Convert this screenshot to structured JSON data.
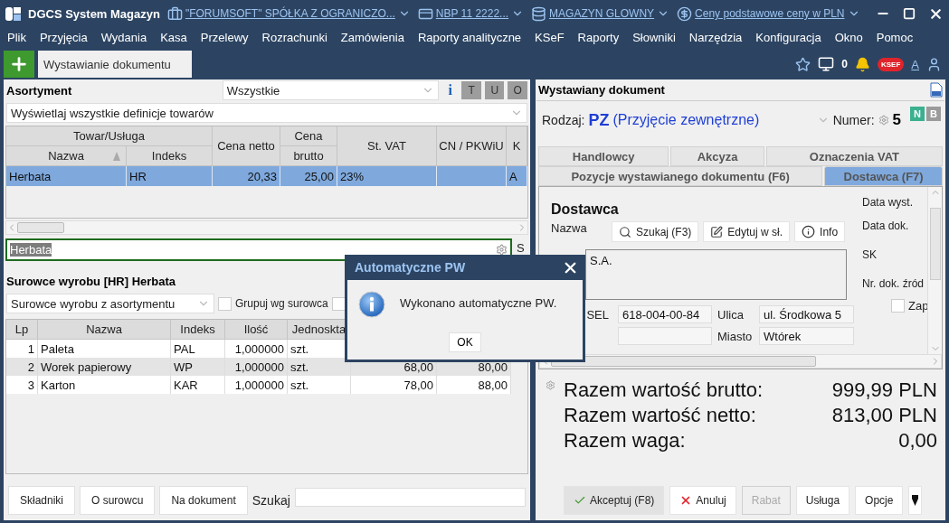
{
  "window": {
    "app_title": "DGCS System Magazyn",
    "context": [
      {
        "kind": "company",
        "label": "\"FORUMSOFT\" SPÓŁKA Z OGRANICZO..."
      },
      {
        "kind": "bank",
        "label": "NBP 11 2222..."
      },
      {
        "kind": "warehouse",
        "label": "MAGAZYN GLOWNY"
      },
      {
        "kind": "prices",
        "label": "Ceny podstawowe ceny w PLN"
      }
    ]
  },
  "menu": [
    "Plik",
    "Przyjęcia",
    "Wydania",
    "Kasa",
    "Przelewy",
    "Rozrachunki",
    "Zamówienia",
    "Raporty analityczne",
    "KSeF",
    "Raporty",
    "Słowniki",
    "Narzędzia",
    "Konfiguracja",
    "Okno",
    "Pomoc"
  ],
  "tabs": [
    {
      "label": "Wystawianie dokumentu",
      "selected": true
    }
  ],
  "toolbar": {
    "monitor_count": "0",
    "ksef": "KSEF",
    "font_size": "A"
  },
  "assortment": {
    "title": "Asortyment",
    "filter": "Wszystkie",
    "info": "i",
    "view_buttons": [
      "T",
      "U",
      "O"
    ],
    "definitions": "Wyświetlaj wszystkie definicje towarów",
    "table": {
      "group_label": "Towar/Usługa",
      "name_column": {
        "label": "Nazwa",
        "sorted": true
      },
      "index_column": "Indeks",
      "net_column": "Cena netto",
      "gross_column": [
        "Cena",
        "brutto"
      ],
      "vat_column": "St. VAT",
      "cn_column": "CN / PKWiU",
      "column_7": "K",
      "rows": [
        {
          "name": "Herbata",
          "index": "HR",
          "net": "20,33",
          "gross": "25,00",
          "vat": "23%",
          "column_7": "A",
          "selected": true
        }
      ]
    },
    "search": {
      "value": "Herbata",
      "trailing": "S"
    }
  },
  "components": {
    "title": "Surowce wyrobu [HR] Herbata",
    "source": "Surowce wyrobu z asortymentu",
    "checkboxes": [
      {
        "label": "Grupuj wg surowca",
        "checked": false
      },
      {
        "checked": false
      }
    ],
    "columns": [
      "Lp",
      "Nazwa",
      "Indeks",
      "Ilość",
      "Jednoskta"
    ],
    "rows": [
      {
        "lp": "1",
        "name": "Paleta",
        "index": "PAL",
        "qty": "1,000000",
        "unit": "szt."
      },
      {
        "lp": "2",
        "name": "Worek papierowy",
        "index": "WP",
        "qty": "1,000000",
        "unit": "szt.",
        "column_6": "68,00",
        "column_7": "80,00"
      },
      {
        "lp": "3",
        "name": "Karton",
        "index": "KAR",
        "qty": "1,000000",
        "unit": "szt.",
        "column_6": "78,00",
        "column_7": "88,00"
      }
    ],
    "buttons": [
      "Składniki",
      "O surowcu",
      "Na dokument"
    ],
    "search_label": "Szukaj"
  },
  "document": {
    "title": "Wystawiany dokument",
    "type_label": "Rodzaj:",
    "type_code": "PZ",
    "type_name": "(Przyjęcie zewnętrzne)",
    "number_label": "Numer:",
    "number": "5",
    "flags": [
      {
        "label": "N",
        "on": true
      },
      {
        "label": "B",
        "on": false
      }
    ],
    "tab_rows": [
      {
        "tabs": [
          {
            "label": "Handlowcy",
            "selected": false
          },
          {
            "label": "Akcyza",
            "selected": false
          },
          {
            "label": "Oznaczenia VAT",
            "selected": false
          }
        ]
      },
      {
        "tabs": [
          {
            "label": "Pozycje wystawianego dokumentu (F6)",
            "selected": false
          },
          {
            "label": "Dostawca (F7)",
            "selected": true
          }
        ]
      }
    ],
    "supplier": {
      "heading": "Dostawca",
      "name_label": "Nazwa",
      "actions": [
        {
          "kind": "search",
          "label": "Szukaj (F3)"
        },
        {
          "kind": "edit",
          "label": "Edytuj w sł."
        },
        {
          "kind": "info",
          "label": "Info"
        }
      ],
      "name": "S.A.",
      "tax_label": "SEL",
      "tax_id": "618-004-00-84",
      "street_label": "Ulica",
      "street": "ul. Środkowa 5",
      "city_label": "Miasto",
      "city": "Wtórek",
      "side_labels": [
        "Data wyst.",
        "Data dok.",
        "SK",
        "Nr. dok. źród"
      ],
      "side_check": {
        "label": "Zap",
        "checked": false
      }
    },
    "totals": [
      {
        "label": "Razem wartość brutto:",
        "value": "999,99 PLN"
      },
      {
        "label": "Razem wartość netto:",
        "value": "813,00 PLN"
      },
      {
        "label": "Razem waga:",
        "value": "0,00"
      }
    ],
    "actions": [
      {
        "kind": "accept",
        "label": "Akceptuj (F8)",
        "disabled": false
      },
      {
        "kind": "cancel",
        "label": "Anuluj",
        "disabled": false
      },
      {
        "kind": "plain",
        "label": "Rabat",
        "disabled": true
      },
      {
        "kind": "plain",
        "label": "Usługa",
        "disabled": false
      },
      {
        "kind": "plain",
        "label": "Opcje",
        "disabled": false
      },
      {
        "kind": "menu",
        "disabled": false
      }
    ]
  },
  "dialog": {
    "title": "Automatyczne PW",
    "message": "Wykonano automatyczne PW.",
    "button": "OK"
  }
}
